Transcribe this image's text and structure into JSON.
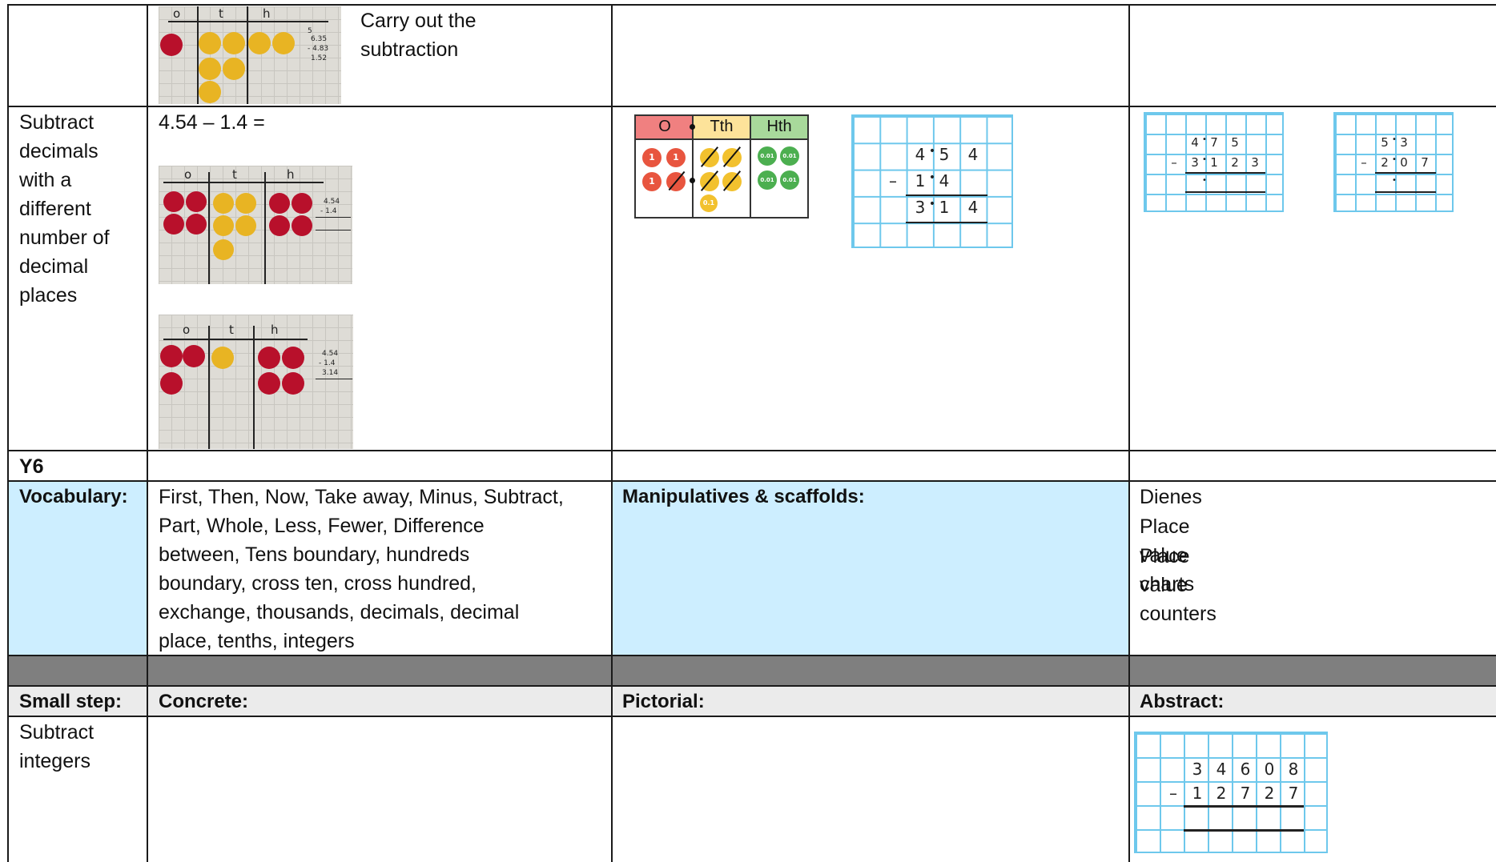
{
  "row_top": {
    "concrete_caption": "Carry out the\nsubtraction",
    "concrete_photo_marks": [
      "o",
      "t",
      "h"
    ],
    "concrete_photo_sum": [
      "5",
      "6.35",
      "- 4.83",
      "1.52"
    ]
  },
  "row_decimals": {
    "small_step": "Subtract\ndecimals\nwith a\ndifferent\nnumber of\ndecimal\nplaces",
    "concrete_question": "4.54 – 1.4 =",
    "photo_marks": [
      "o",
      "t",
      "h"
    ],
    "photo1_sum": [
      "4.54",
      "- 1.4"
    ],
    "photo2_sum": [
      "4.54",
      "- 1.4",
      "3.14"
    ],
    "pictorial_chart": {
      "headers": [
        "O",
        "Tth",
        "Hth"
      ],
      "header_colors": [
        "#f08080",
        "#fde39a",
        "#a8d99b"
      ],
      "coin_ones": "1",
      "coin_tenths": "0.1",
      "coin_hundredths": "0.01"
    },
    "pictorial_calc": {
      "row1": [
        "4",
        "•",
        "5",
        "4"
      ],
      "row2": [
        "–",
        "1",
        "•",
        "4"
      ],
      "row3": [
        "3",
        "•",
        "1",
        "4"
      ]
    },
    "abstract_calc1": {
      "row1": [
        "4",
        "•",
        "7",
        "5"
      ],
      "row2": [
        "–",
        "3",
        "•",
        "1",
        "2",
        "3"
      ],
      "row3": [
        "•"
      ]
    },
    "abstract_calc2": {
      "row1": [
        "5",
        "•",
        "3"
      ],
      "row2": [
        "–",
        "2",
        "•",
        "0",
        "7"
      ],
      "row3": [
        "•"
      ]
    }
  },
  "year_row": {
    "label": "Y6"
  },
  "vocab_row": {
    "vocabulary_label": "Vocabulary:",
    "vocabulary_text": "First, Then, Now, Take away, Minus, Subtract,\nPart, Whole, Less, Fewer, Difference\nbetween, Tens boundary, hundreds\nboundary, cross ten, cross hundred,\nexchange, thousands, decimals, decimal\nplace, tenths, integers",
    "manipulatives_label": "Manipulatives & scaffolds:",
    "manipulatives_list": [
      "Dienes",
      "Place value charts",
      "Place value counters"
    ]
  },
  "header_row": {
    "small_step": "Small step:",
    "concrete": "Concrete:",
    "pictorial": "Pictorial:",
    "abstract": "Abstract:"
  },
  "row_integers": {
    "small_step": "Subtract\nintegers",
    "abstract_calc": {
      "row1": [
        "3",
        "4",
        "6",
        "0",
        "8"
      ],
      "row2": [
        "–",
        "1",
        "2",
        "7",
        "2",
        "7"
      ]
    }
  },
  "colors": {
    "cell_blue": "#cdeeff",
    "band_grey": "#7f7f7f",
    "grid_blue": "#6ec8ec",
    "counter_red": "#b8102b",
    "counter_yellow": "#e8b423"
  }
}
